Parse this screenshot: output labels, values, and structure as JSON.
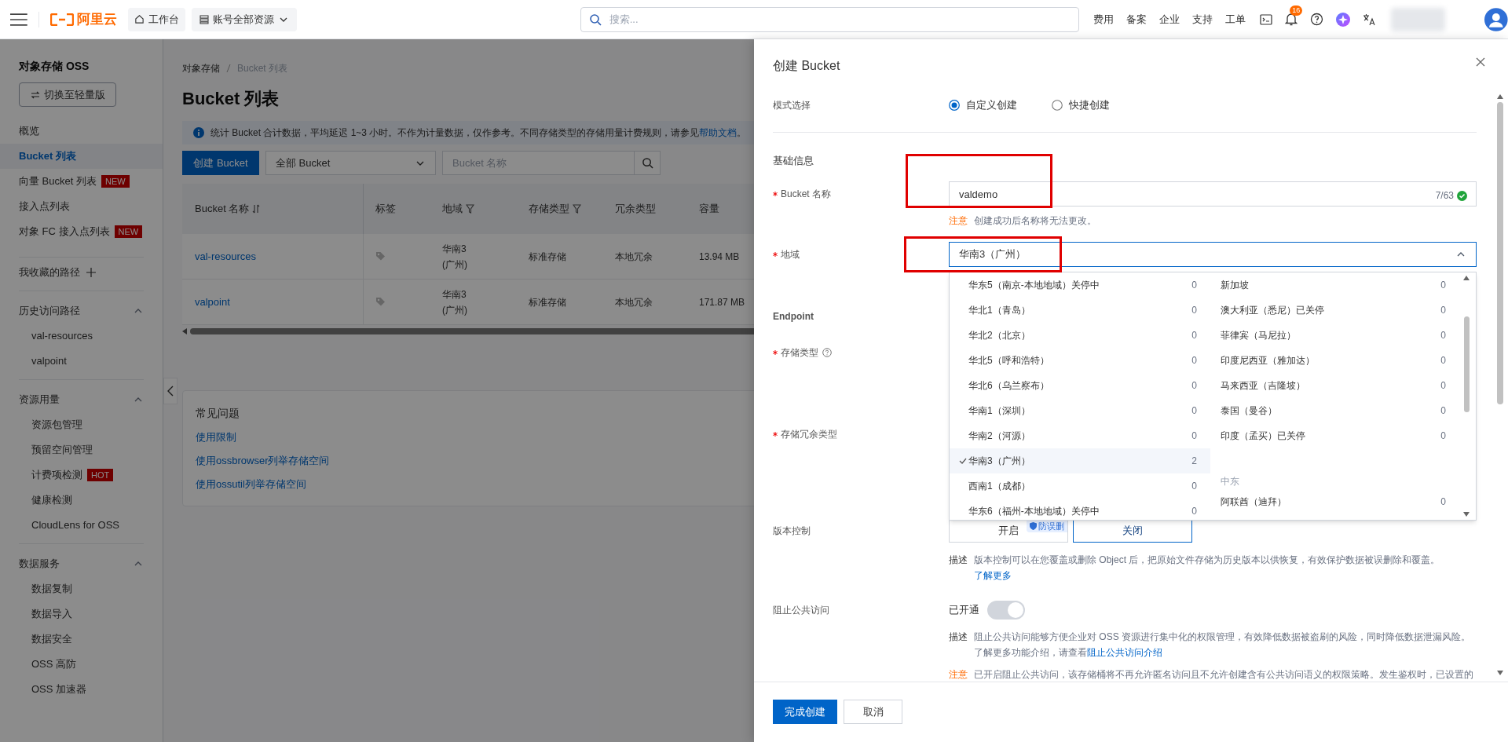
{
  "topbar": {
    "logo": "阿里云",
    "workbench": "工作台",
    "resources": "账号全部资源",
    "search_placeholder": "搜索...",
    "links": [
      "费用",
      "备案",
      "企业",
      "支持",
      "工单"
    ],
    "notification_count": "16"
  },
  "sidebar": {
    "title": "对象存储 OSS",
    "switch_button": "切换至轻量版",
    "nav": [
      {
        "label": "概览",
        "selected": false
      },
      {
        "label": "Bucket 列表",
        "selected": true
      },
      {
        "label": "向量 Bucket 列表",
        "selected": false,
        "badge": "NEW"
      },
      {
        "label": "接入点列表",
        "selected": false
      },
      {
        "label": "对象 FC 接入点列表",
        "selected": false,
        "badge": "NEW"
      }
    ],
    "favorites": "我收藏的路径",
    "sections": [
      {
        "title": "历史访问路径",
        "expanded": true,
        "items": [
          {
            "label": "val-resources",
            "selected": false
          },
          {
            "label": "valpoint",
            "selected": false
          }
        ]
      },
      {
        "title": "资源用量",
        "expanded": true,
        "items": [
          {
            "label": "资源包管理",
            "selected": false
          },
          {
            "label": "预留空间管理",
            "selected": false
          },
          {
            "label": "计费项检测",
            "selected": false,
            "badge": "HOT"
          },
          {
            "label": "健康检测",
            "selected": false
          },
          {
            "label": "CloudLens for OSS",
            "selected": false
          }
        ]
      },
      {
        "title": "数据服务",
        "expanded": true,
        "items": [
          {
            "label": "数据复制",
            "selected": false
          },
          {
            "label": "数据导入",
            "selected": false
          },
          {
            "label": "数据安全",
            "selected": false
          },
          {
            "label": "OSS 高防",
            "selected": false
          },
          {
            "label": "OSS 加速器",
            "selected": false
          }
        ]
      }
    ]
  },
  "main": {
    "breadcrumb": [
      "对象存储",
      "Bucket 列表"
    ],
    "title": "Bucket 列表",
    "info": {
      "text": "统计 Bucket 合计数据，平均延迟 1~3 小时。不作为计量数据，仅作参考。不同存储类型的存储用量计费规则，请参见",
      "link": "帮助文档",
      "end": "。"
    },
    "create_button": "创建 Bucket",
    "filter_select": "全部 Bucket",
    "search_placeholder": "Bucket 名称",
    "table": {
      "columns": [
        {
          "label": "Bucket 名称",
          "kind": "sort"
        },
        {
          "label": "标签",
          "kind": "plain"
        },
        {
          "label": "地域",
          "kind": "filter"
        },
        {
          "label": "存储类型",
          "kind": "filter"
        },
        {
          "label": "冗余类型",
          "kind": "plain"
        },
        {
          "label": "容量",
          "kind": "plain"
        }
      ],
      "rows": [
        {
          "name": "val-resources",
          "region": "华南3 (广州)",
          "storage": "标准存储",
          "redundancy": "本地冗余",
          "capacity": "13.94 MB"
        },
        {
          "name": "valpoint",
          "region": "华南3 (广州)",
          "storage": "标准存储",
          "redundancy": "本地冗余",
          "capacity": "171.87 MB"
        }
      ]
    },
    "faq": {
      "title": "常见问题",
      "links": [
        "使用限制",
        "使用ossbrowser列举存储空间",
        "使用ossutil列举存储空间"
      ]
    }
  },
  "drawer": {
    "title": "创建 Bucket",
    "mode": {
      "label": "模式选择",
      "options": [
        {
          "label": "自定义创建",
          "selected": true
        },
        {
          "label": "快捷创建",
          "selected": false
        }
      ]
    },
    "section": "基础信息",
    "name_field": {
      "label": "Bucket 名称",
      "required": true,
      "value": "valdemo",
      "counter": "7/63",
      "valid": true
    },
    "name_note": {
      "tag": "注意",
      "text": "创建成功后名称将无法更改。"
    },
    "region": {
      "label": "地域",
      "required": true,
      "value": "华南3（广州）",
      "expanded": true,
      "options_left": [
        {
          "label": "华东5（南京-本地地域）关停中",
          "count": "0",
          "selected": false
        },
        {
          "label": "华北1（青岛）",
          "count": "0",
          "selected": false
        },
        {
          "label": "华北2（北京）",
          "count": "0",
          "selected": false
        },
        {
          "label": "华北5（呼和浩特）",
          "count": "0",
          "selected": false
        },
        {
          "label": "华北6（乌兰察布）",
          "count": "0",
          "selected": false
        },
        {
          "label": "华南1（深圳）",
          "count": "0",
          "selected": false
        },
        {
          "label": "华南2（河源）",
          "count": "0",
          "selected": false
        },
        {
          "label": "华南3（广州）",
          "count": "2",
          "selected": true
        },
        {
          "label": "西南1（成都）",
          "count": "0",
          "selected": false
        },
        {
          "label": "华东6（福州-本地地域）关停中",
          "count": "0",
          "selected": false
        }
      ],
      "options_right": [
        {
          "kind": "option",
          "label": "新加坡",
          "count": "0",
          "selected": false
        },
        {
          "kind": "option",
          "label": "澳大利亚（悉尼）已关停",
          "count": "0",
          "selected": false
        },
        {
          "kind": "option",
          "label": "菲律宾（马尼拉）",
          "count": "0",
          "selected": false
        },
        {
          "kind": "option",
          "label": "印度尼西亚（雅加达）",
          "count": "0",
          "selected": false
        },
        {
          "kind": "option",
          "label": "马来西亚（吉隆坡）",
          "count": "0",
          "selected": false
        },
        {
          "kind": "option",
          "label": "泰国（曼谷）",
          "count": "0",
          "selected": false
        },
        {
          "kind": "option",
          "label": "印度（孟买）已关停",
          "count": "0",
          "selected": false
        },
        {
          "kind": "group",
          "label": "中东"
        },
        {
          "kind": "option",
          "label": "阿联酋（迪拜）",
          "count": "0",
          "selected": false
        }
      ]
    },
    "endpoint_label": "Endpoint",
    "storage_type": {
      "label": "存储类型",
      "required": true
    },
    "redundancy": {
      "label": "存储冗余类型",
      "required": true
    },
    "versioning": {
      "label": "版本控制",
      "options": [
        {
          "label": "开启",
          "badge": "防误删",
          "selected": false
        },
        {
          "label": "关闭",
          "selected": true
        }
      ],
      "desc_tag": "描述",
      "desc": "版本控制可以在您覆盖或删除 Object 后，把原始文件存储为历史版本以供恢复，有效保护数据被误删除和覆盖。",
      "desc_link": "了解更多"
    },
    "block_public": {
      "label": "阻止公共访问",
      "status": "已开通",
      "on": true,
      "disabled": true,
      "desc_tag": "描述",
      "desc": "阻止公共访问能够方便企业对 OSS 资源进行集中化的权限管理，有效降低数据被盗刷的风险，同时降低数据泄漏风险。了解更多功能介绍，请查看",
      "desc_link": "阻止公共访问介绍",
      "note_tag": "注意",
      "note": "已开启阻止公共访问，该存储桶将不再允许匿名访问且不允许创建含有公共访问语义的权限策略。发生鉴权时，已设置的"
    },
    "footer_buttons": [
      {
        "label": "完成创建",
        "kind": "primary"
      },
      {
        "label": "取消",
        "kind": "secondary"
      }
    ]
  }
}
